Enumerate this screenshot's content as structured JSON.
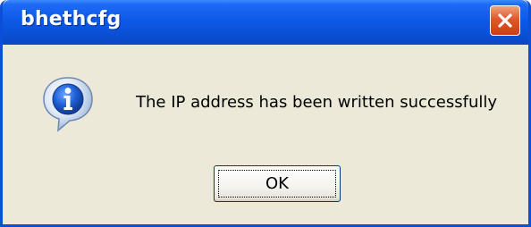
{
  "window": {
    "title": "bhethcfg",
    "titlebar_color": "#0b58e6",
    "close_icon": "close-icon",
    "close_button_color": "#e0582b",
    "background_color": "#ece9d8"
  },
  "dialog": {
    "icon": "info-icon",
    "message": "The IP address has been written successfully",
    "ok_label": "OK"
  }
}
